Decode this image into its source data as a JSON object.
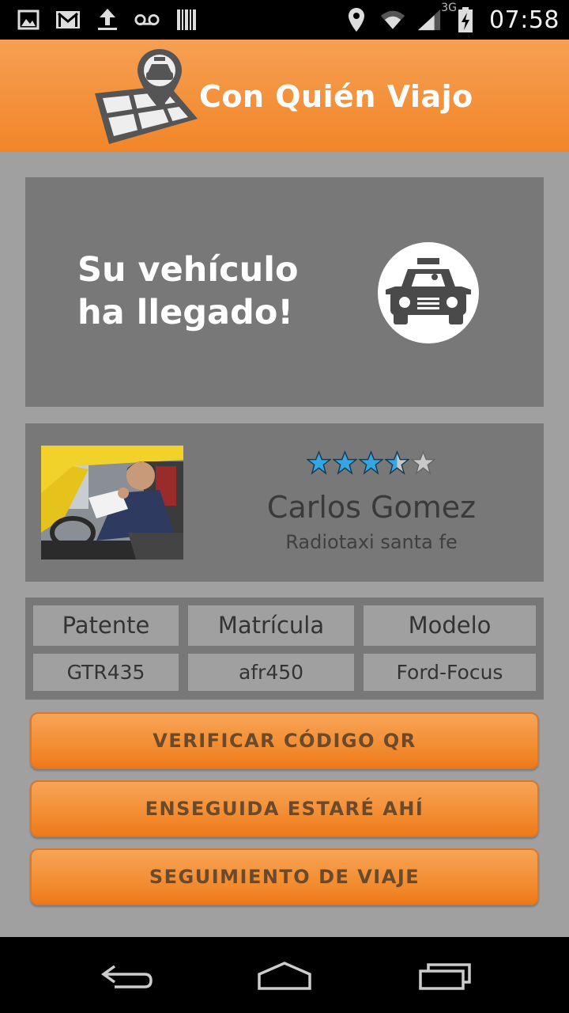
{
  "status_bar": {
    "time": "07:58",
    "network": "3G",
    "icons": [
      "image-icon",
      "gmail-icon",
      "upload-icon",
      "voicemail-icon",
      "barcode-icon",
      "location-icon",
      "wifi-icon",
      "signal-icon",
      "battery-charging-icon"
    ]
  },
  "header": {
    "title": "Con Quién Viajo",
    "logo_icon": "map-taxi-pin-icon",
    "colors": {
      "gradient_top": "#f6a053",
      "gradient_bottom": "#f28528"
    }
  },
  "arrival": {
    "message": "Su vehículo ha llegado!",
    "icon": "taxi-icon"
  },
  "driver": {
    "name": "Carlos Gomez",
    "company": "Radiotaxi santa fe",
    "rating": 3.5,
    "rating_max": 5,
    "photo": "driver-photo"
  },
  "vehicle": {
    "headers": [
      "Patente",
      "Matrícula",
      "Modelo"
    ],
    "values": [
      "GTR435",
      "afr450",
      "Ford-Focus"
    ]
  },
  "actions": {
    "verify_qr": "VERIFICAR CÓDIGO QR",
    "on_my_way": "ENSEGUIDA ESTARÉ AHÍ",
    "trip_tracking": "SEGUIMIENTO DE VIAJE"
  },
  "colors": {
    "accent": "#f28528",
    "panel": "#797878",
    "background": "#a0a0a0",
    "star": "#33a6e3"
  }
}
